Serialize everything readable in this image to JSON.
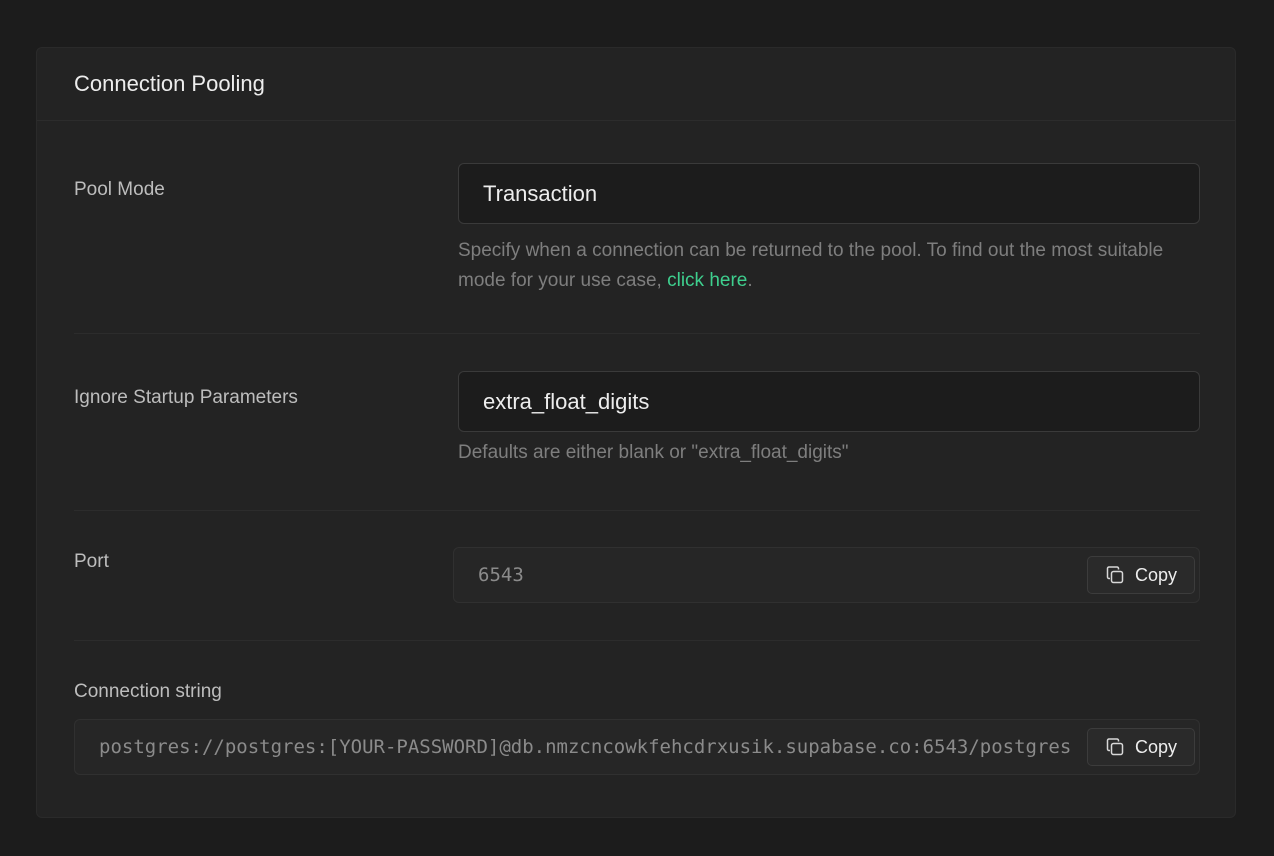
{
  "panel": {
    "title": "Connection Pooling"
  },
  "pool_mode": {
    "label": "Pool Mode",
    "value": "Transaction",
    "help_text": "Specify when a connection can be returned to the pool. To find out the most suitable mode for your use case, ",
    "help_link": "click here",
    "help_suffix": "."
  },
  "ignore_startup": {
    "label": "Ignore Startup Parameters",
    "value": "extra_float_digits",
    "help_text": "Defaults are either blank or \"extra_float_digits\""
  },
  "port": {
    "label": "Port",
    "value": "6543",
    "copy_label": "Copy"
  },
  "connection_string": {
    "label": "Connection string",
    "value": "postgres://postgres:[YOUR-PASSWORD]@db.nmzcncowkfehcdrxusik.supabase.co:6543/postgres",
    "copy_label": "Copy"
  },
  "icons": {
    "copy": "copy-icon"
  },
  "colors": {
    "background": "#1c1c1c",
    "panel": "#232323",
    "link": "#3ecf8e"
  }
}
